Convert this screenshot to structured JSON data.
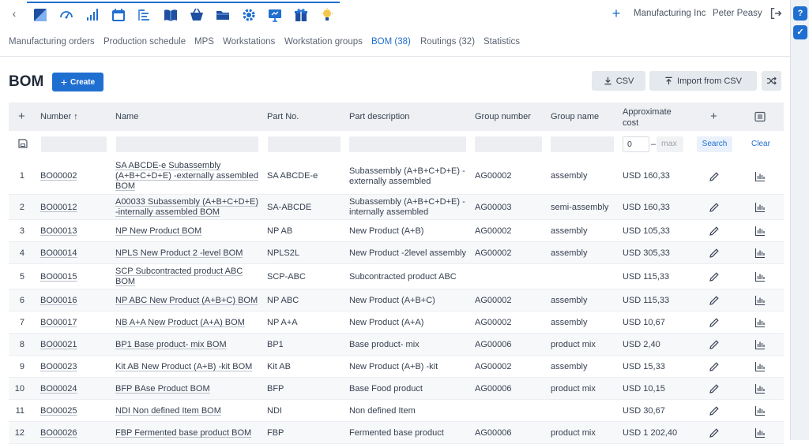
{
  "nav": {
    "back_icon": "chevron-left-icon",
    "apps": [
      {
        "name": "logo-icon",
        "color": "#1e4fa0"
      },
      {
        "name": "dashboard-gauge-icon",
        "color": "#1f6fd0"
      },
      {
        "name": "bar-signal-icon",
        "color": "#1f6fd0"
      },
      {
        "name": "calendar-icon",
        "color": "#1f6fd0"
      },
      {
        "name": "production-list-icon",
        "color": "#1f6fd0"
      },
      {
        "name": "book-icon",
        "color": "#1f6fd0"
      },
      {
        "name": "basket-icon",
        "color": "#1f6fd0"
      },
      {
        "name": "folder-icon",
        "color": "#1f6fd0"
      },
      {
        "name": "gear-icon",
        "color": "#1f6fd0"
      },
      {
        "name": "presentation-icon",
        "color": "#1f6fd0"
      },
      {
        "name": "gift-icon",
        "color": "#1f6fd0"
      },
      {
        "name": "lightbulb-icon",
        "color": "#1f6fd0"
      }
    ],
    "company": "Manufacturing Inc",
    "user": "Peter Peasy"
  },
  "tabs": [
    {
      "label": "Manufacturing orders",
      "active": false
    },
    {
      "label": "Production schedule",
      "active": false
    },
    {
      "label": "MPS",
      "active": false
    },
    {
      "label": "Workstations",
      "active": false
    },
    {
      "label": "Workstation groups",
      "active": false
    },
    {
      "label": "BOM (38)",
      "active": true
    },
    {
      "label": "Routings (32)",
      "active": false
    },
    {
      "label": "Statistics",
      "active": false
    }
  ],
  "page": {
    "title": "BOM",
    "create_label": "Create",
    "csv_label": "CSV",
    "import_label": "Import from CSV"
  },
  "table": {
    "headers": {
      "number": "Number ↑",
      "name": "Name",
      "part_no": "Part No.",
      "part_description": "Part description",
      "group_number": "Group number",
      "group_name": "Group name",
      "approx_cost_1": "Approximate",
      "approx_cost_2": "cost"
    },
    "filter": {
      "min_value": "0",
      "dash": "–",
      "max_placeholder": "max",
      "search_label": "Search",
      "clear_label": "Clear"
    },
    "rows": [
      {
        "idx": "1",
        "number": "BO00002",
        "name": [
          "SA ABCDE-e Subassembly",
          "(A+B+C+D+E) -externally assembled",
          "BOM"
        ],
        "part_no": "SA ABCDE-e",
        "desc": [
          "Subassembly (A+B+C+D+E) -",
          "externally assembled"
        ],
        "group_number": "AG00002",
        "group_name": "assembly",
        "cost": "USD 160,33"
      },
      {
        "idx": "2",
        "number": "BO00012",
        "name": [
          "A00033 Subassembly (A+B+C+D+E)",
          "-internally assembled BOM"
        ],
        "part_no": "SA-ABCDE",
        "desc": [
          "Subassembly (A+B+C+D+E) -",
          "internally assembled"
        ],
        "group_number": "AG00003",
        "group_name": "semi-assembly",
        "cost": "USD 160,33"
      },
      {
        "idx": "3",
        "number": "BO00013",
        "name": [
          "NP New Product BOM"
        ],
        "part_no": "NP AB",
        "desc": [
          "New Product (A+B)"
        ],
        "group_number": "AG00002",
        "group_name": "assembly",
        "cost": "USD 105,33"
      },
      {
        "idx": "4",
        "number": "BO00014",
        "name": [
          "NPLS New Product 2 -level BOM"
        ],
        "part_no": "NPLS2L",
        "desc": [
          "New Product -2level assembly"
        ],
        "group_number": "AG00002",
        "group_name": "assembly",
        "cost": "USD 305,33"
      },
      {
        "idx": "5",
        "number": "BO00015",
        "name": [
          "SCP Subcontracted product ABC",
          "BOM"
        ],
        "part_no": "SCP-ABC",
        "desc": [
          "Subcontracted product ABC"
        ],
        "group_number": "",
        "group_name": "",
        "cost": "USD 115,33"
      },
      {
        "idx": "6",
        "number": "BO00016",
        "name": [
          "NP ABC New Product (A+B+C) BOM"
        ],
        "part_no": "NP ABC",
        "desc": [
          "New Product (A+B+C)"
        ],
        "group_number": "AG00002",
        "group_name": "assembly",
        "cost": "USD 115,33"
      },
      {
        "idx": "7",
        "number": "BO00017",
        "name": [
          "NB A+A New Product (A+A) BOM"
        ],
        "part_no": "NP A+A",
        "desc": [
          "New Product (A+A)"
        ],
        "group_number": "AG00002",
        "group_name": "assembly",
        "cost": "USD 10,67"
      },
      {
        "idx": "8",
        "number": "BO00021",
        "name": [
          "BP1 Base product- mix BOM"
        ],
        "part_no": "BP1",
        "desc": [
          "Base product- mix"
        ],
        "group_number": "AG00006",
        "group_name": "product mix",
        "cost": "USD 2,40"
      },
      {
        "idx": "9",
        "number": "BO00023",
        "name": [
          "Kit AB New Product (A+B) -kit BOM"
        ],
        "part_no": "Kit AB",
        "desc": [
          "New Product (A+B) -kit"
        ],
        "group_number": "AG00002",
        "group_name": "assembly",
        "cost": "USD 15,33"
      },
      {
        "idx": "10",
        "number": "BO00024",
        "name": [
          "BFP BAse Product BOM"
        ],
        "part_no": "BFP",
        "desc": [
          "Base Food product"
        ],
        "group_number": "AG00006",
        "group_name": "product mix",
        "cost": "USD 10,15"
      },
      {
        "idx": "11",
        "number": "BO00025",
        "name": [
          "NDI Non defined Item BOM"
        ],
        "part_no": "NDI",
        "desc": [
          "Non defined Item"
        ],
        "group_number": "",
        "group_name": "",
        "cost": "USD 30,67"
      },
      {
        "idx": "12",
        "number": "BO00026",
        "name": [
          "FBP Fermented base product BOM"
        ],
        "part_no": "FBP",
        "desc": [
          "Fermented base product"
        ],
        "group_number": "AG00006",
        "group_name": "product mix",
        "cost": "USD 1 202,40"
      }
    ]
  },
  "colors": {
    "accent": "#1f6fd0",
    "header_bg": "#eef0f3"
  }
}
